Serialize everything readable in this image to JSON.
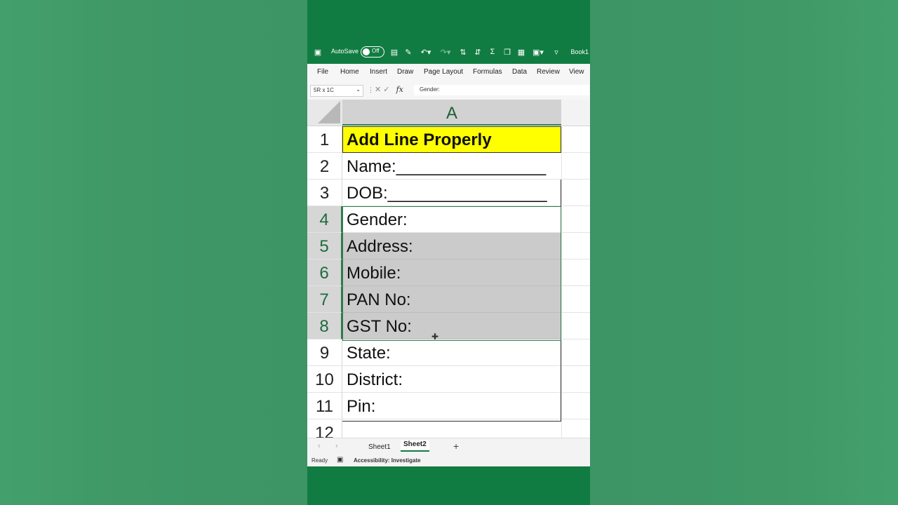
{
  "titlebar": {
    "autosave_label": "AutoSave",
    "autosave_state": "Off",
    "book_title": "Book1"
  },
  "ribbon": {
    "tabs": [
      "File",
      "Home",
      "Insert",
      "Draw",
      "Page Layout",
      "Formulas",
      "Data",
      "Review",
      "View"
    ]
  },
  "formula_bar": {
    "name_box": "5R x 1C",
    "content": "Gender:"
  },
  "grid": {
    "column_header": "A",
    "rows": [
      {
        "num": "1",
        "value": "Add Line Properly"
      },
      {
        "num": "2",
        "value": "Name:________________"
      },
      {
        "num": "3",
        "value": "DOB:_________________"
      },
      {
        "num": "4",
        "value": "Gender:"
      },
      {
        "num": "5",
        "value": "Address:"
      },
      {
        "num": "6",
        "value": "Mobile:"
      },
      {
        "num": "7",
        "value": "PAN No:"
      },
      {
        "num": "8",
        "value": "GST No:"
      },
      {
        "num": "9",
        "value": "State:"
      },
      {
        "num": "10",
        "value": "District:"
      },
      {
        "num": "11",
        "value": "Pin:"
      },
      {
        "num": "12",
        "value": ""
      }
    ]
  },
  "sheet_tabs": {
    "tabs": [
      "Sheet1",
      "Sheet2"
    ],
    "active": "Sheet2",
    "add": "+"
  },
  "status_bar": {
    "ready": "Ready",
    "accessibility": "Accessibility: Investigate"
  },
  "colors": {
    "excel_green": "#107c41",
    "title_fill": "#ffff00",
    "selection_fill": "#cbcbcb"
  }
}
